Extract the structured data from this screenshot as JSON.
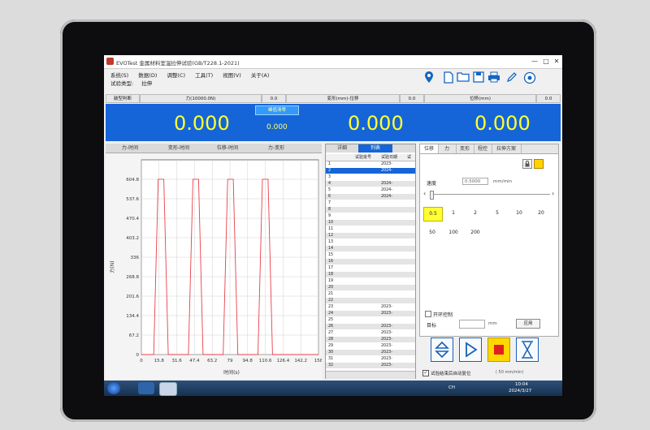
{
  "window": {
    "title": "EVOTest 金属材料室温拉伸试验(GB/T228.1-2021)",
    "controls": [
      "—",
      "□",
      "✕"
    ]
  },
  "menu": {
    "items": [
      "系统(S)",
      "数据(D)",
      "调整(C)",
      "工具(T)",
      "视图(V)",
      "关于(A)"
    ],
    "test_type_label": "试验类型:",
    "test_type_value": "拉伸"
  },
  "toolbar": {
    "icons": [
      "location-icon",
      "new-file-icon",
      "open-folder-icon",
      "save-icon",
      "print-icon",
      "edit-icon",
      "record-icon"
    ]
  },
  "readout": {
    "break_label": "破型判断",
    "force_label": "力(10000.0N)",
    "force_zero_value": "0.0",
    "deform_label": "变形(mm)-位移",
    "deform_zero_value": "0.0",
    "displacement_label": "位移(mm)",
    "displacement_zero_value": "0.0",
    "force_value": "0.000",
    "peak_button": "峰值清零",
    "peak_value": "0.000",
    "deform_value": "0.000",
    "displacement_value": "0.000"
  },
  "chart_tabs": [
    "力-时间",
    "变形-时间",
    "位移-时间",
    "力-变形"
  ],
  "chart_data": {
    "type": "line",
    "xlabel": "时间(s)",
    "ylabel": "力(N)",
    "xlim": [
      0,
      158
    ],
    "ylim": [
      0,
      672
    ],
    "x_ticks": [
      "0",
      "15.8",
      "31.6",
      "47.4",
      "63.2",
      "79",
      "94.8",
      "110.6",
      "126.4",
      "142.2",
      "158"
    ],
    "y_ticks": [
      "0",
      "67.2",
      "134.4",
      "201.6",
      "268.8",
      "336",
      "403.2",
      "470.4",
      "537.6",
      "604.8"
    ],
    "series": [
      {
        "color": "#e8404a",
        "x": [
          0,
          11,
          15,
          20,
          24,
          42,
          46,
          51,
          55,
          73,
          77,
          82,
          86,
          104,
          108,
          113,
          117,
          158
        ],
        "y": [
          0,
          0,
          605,
          605,
          0,
          0,
          605,
          605,
          0,
          0,
          605,
          605,
          0,
          0,
          605,
          605,
          0,
          0
        ]
      }
    ]
  },
  "table": {
    "tabs": [
      "详细",
      "列表"
    ],
    "headers": [
      "试验批号",
      "试验日期",
      "试"
    ],
    "rows": [
      {
        "n": "1",
        "date": "2023-"
      },
      {
        "n": "2",
        "date": "2024-"
      },
      {
        "n": "3",
        "date": ""
      },
      {
        "n": "4",
        "date": "2024-"
      },
      {
        "n": "5",
        "date": "2024-"
      },
      {
        "n": "6",
        "date": "2024-"
      },
      {
        "n": "7",
        "date": ""
      },
      {
        "n": "8",
        "date": ""
      },
      {
        "n": "9",
        "date": ""
      },
      {
        "n": "10",
        "date": ""
      },
      {
        "n": "11",
        "date": ""
      },
      {
        "n": "12",
        "date": ""
      },
      {
        "n": "13",
        "date": ""
      },
      {
        "n": "14",
        "date": ""
      },
      {
        "n": "15",
        "date": ""
      },
      {
        "n": "16",
        "date": ""
      },
      {
        "n": "17",
        "date": ""
      },
      {
        "n": "18",
        "date": ""
      },
      {
        "n": "19",
        "date": ""
      },
      {
        "n": "20",
        "date": ""
      },
      {
        "n": "21",
        "date": ""
      },
      {
        "n": "22",
        "date": ""
      },
      {
        "n": "23",
        "date": "2023-"
      },
      {
        "n": "24",
        "date": "2023-"
      },
      {
        "n": "25",
        "date": ""
      },
      {
        "n": "26",
        "date": "2023-"
      },
      {
        "n": "27",
        "date": "2023-"
      },
      {
        "n": "28",
        "date": "2023-"
      },
      {
        "n": "29",
        "date": "2023-"
      },
      {
        "n": "30",
        "date": "2023-"
      },
      {
        "n": "31",
        "date": "2023-"
      },
      {
        "n": "32",
        "date": "2023-"
      }
    ],
    "selected_index": 1
  },
  "control": {
    "tabs": [
      "位移",
      "力",
      "变形",
      "程控",
      "拉伸方案"
    ],
    "speed_label": "速度",
    "speed_value": "0.5000",
    "speed_unit": "mm/min",
    "speed_presets_row1": [
      "0.5",
      "1",
      "2",
      "5",
      "10",
      "20"
    ],
    "speed_presets_row2": [
      "50",
      "100",
      "200"
    ],
    "selected_preset": "0.5",
    "ring_control_label": "开环控制",
    "target_label": "目标",
    "target_unit": "mm",
    "apply_button": "应用",
    "reset_label": "试验结束后自动复位",
    "reset_speed": "( 50   mm/min)",
    "accent": "#1565d8"
  },
  "taskbar": {
    "lang": "CH",
    "time": "10:04",
    "date": "2024/3/27"
  }
}
